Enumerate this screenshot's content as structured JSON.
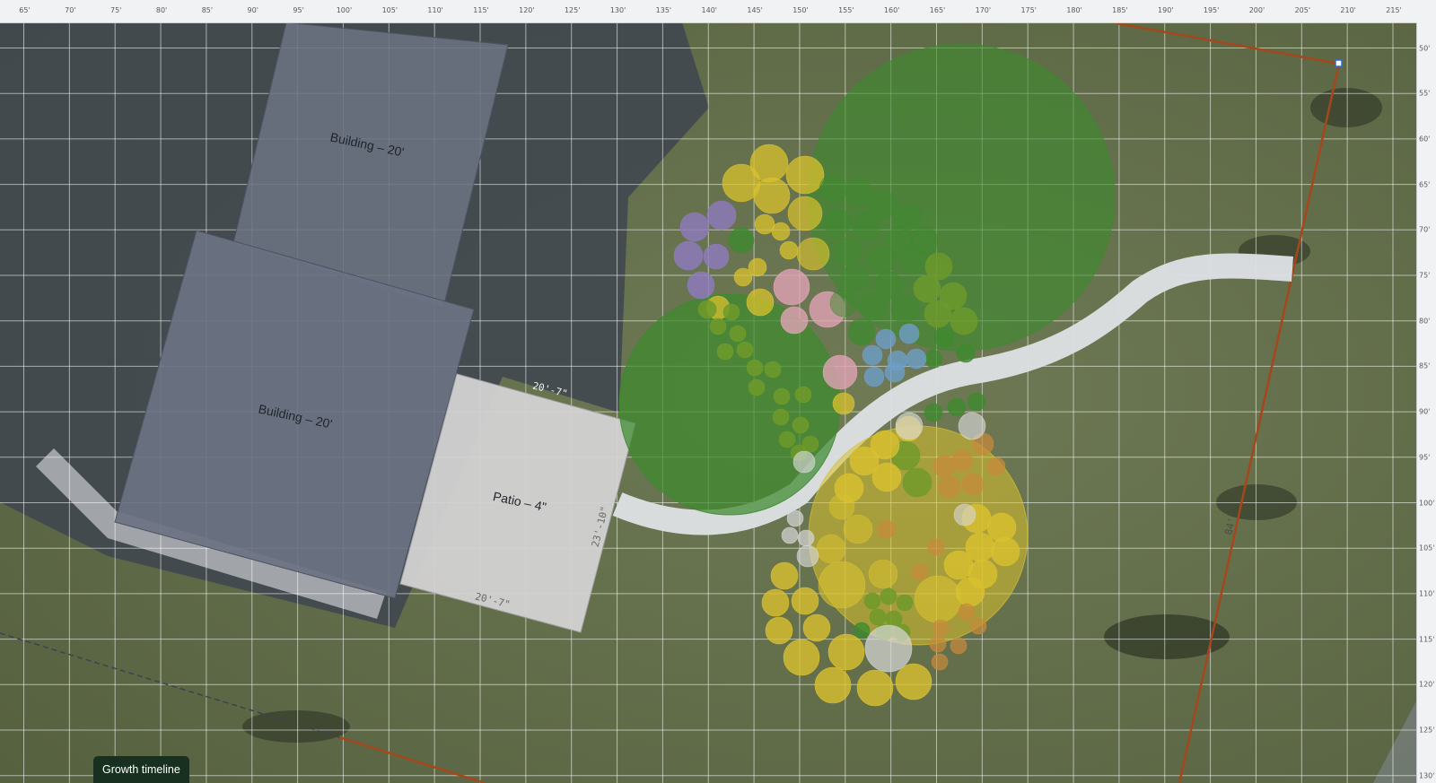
{
  "ruler": {
    "x_labels": [
      "65'",
      "70'",
      "75'",
      "80'",
      "85'",
      "90'",
      "95'",
      "100'",
      "105'",
      "110'",
      "115'",
      "120'",
      "125'",
      "130'",
      "135'",
      "140'",
      "145'",
      "150'",
      "155'",
      "160'",
      "165'",
      "170'",
      "175'",
      "180'",
      "185'",
      "190'",
      "195'",
      "200'",
      "205'",
      "210'",
      "215'"
    ],
    "y_labels": [
      "50'",
      "55'",
      "60'",
      "65'",
      "70'",
      "75'",
      "80'",
      "85'",
      "90'",
      "95'",
      "100'",
      "105'",
      "110'",
      "115'",
      "120'",
      "125'",
      "130'"
    ]
  },
  "structures": {
    "building_upper": {
      "label": "Building – 20'"
    },
    "building_lower": {
      "label": "Building – 20'"
    },
    "patio": {
      "label": "Patio – 4\"",
      "dim_top": "20'-7\"",
      "dim_right": "23'-10\"",
      "dim_bottom": "20'-7\""
    }
  },
  "property_line": {
    "side_label": "84'"
  },
  "colors": {
    "building": "#6b7282",
    "patio": "#d3d2d2",
    "path": "#dcdfe2",
    "property_line": "#a5471c",
    "tree": "#3d8a2e",
    "shrub_yellow": "#d9c12e",
    "shrub_green": "#6e9a2a",
    "shrub_purple": "#8f7bbf",
    "shrub_pink": "#e0a3b4",
    "shrub_blue": "#6d9dc8",
    "shrub_orange": "#c98a3a",
    "shrub_white": "#d8d8d8"
  },
  "controls": {
    "growth_timeline_label": "Growth timeline"
  }
}
